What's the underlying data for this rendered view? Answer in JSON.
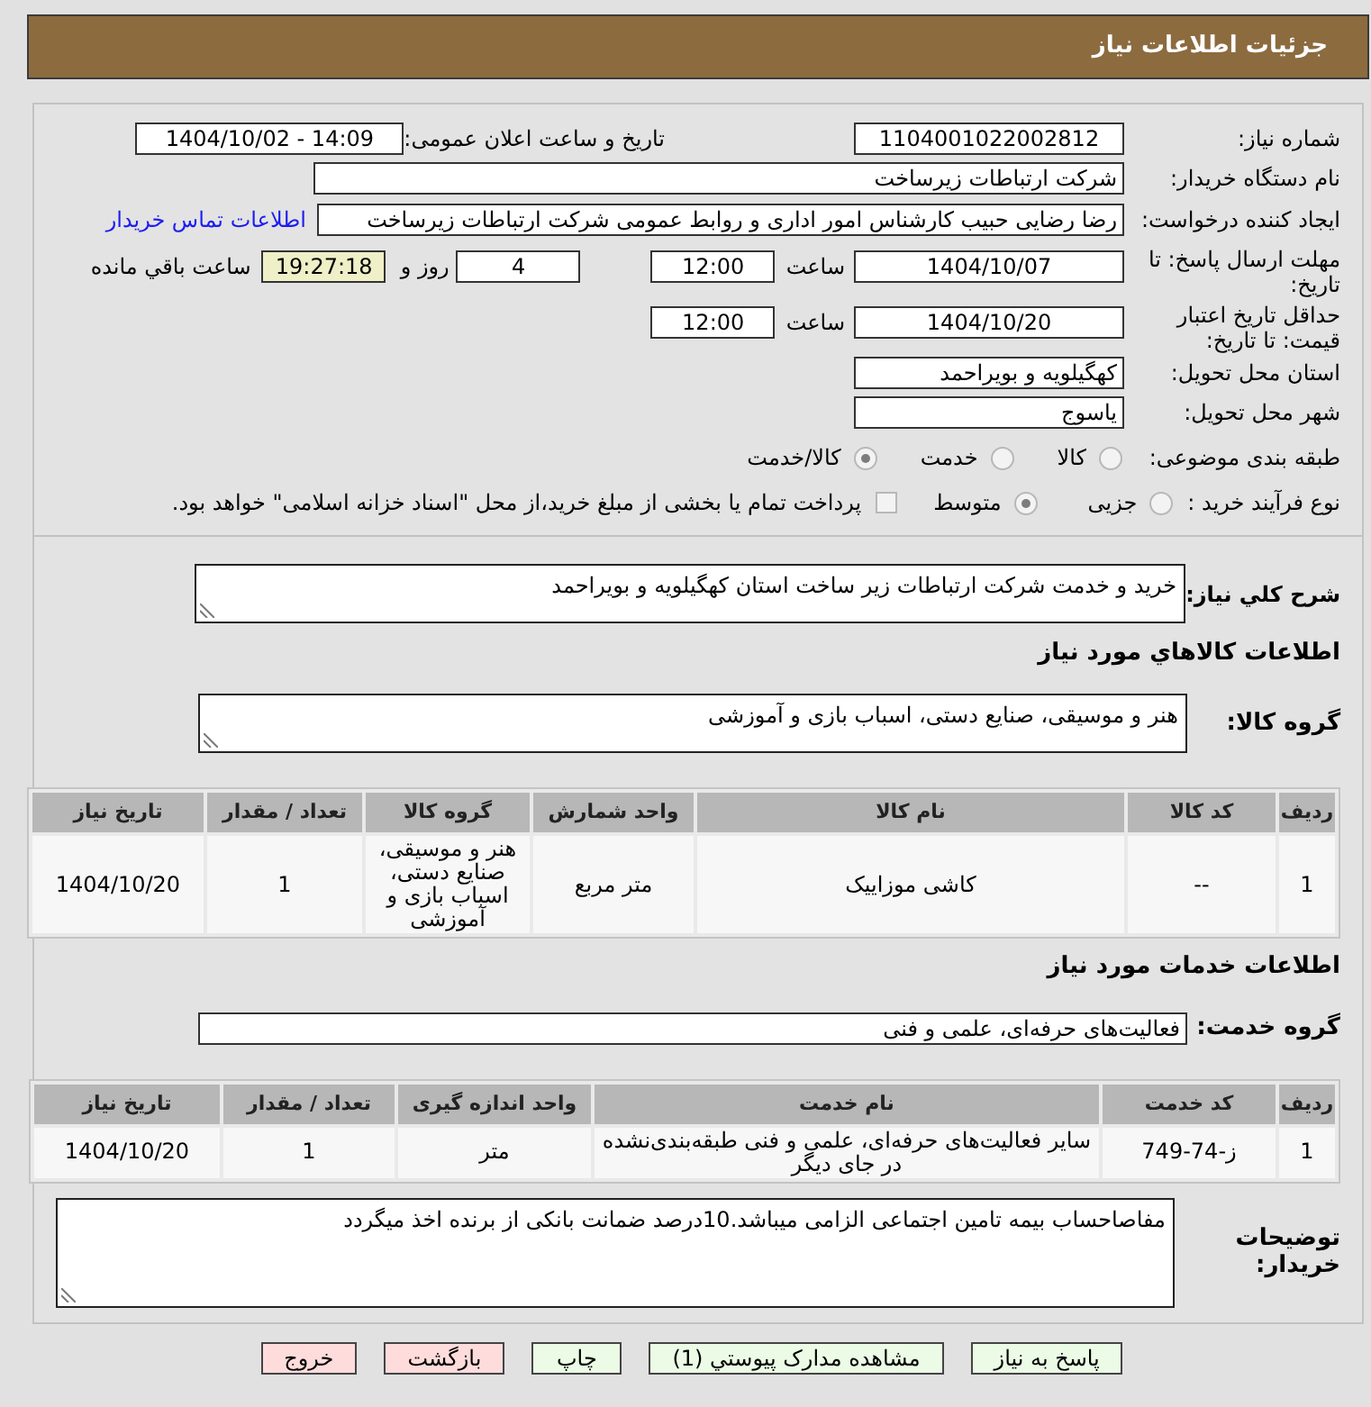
{
  "header": {
    "title": "جزئیات اطلاعات نیاز"
  },
  "details": {
    "need_number": {
      "label": "شماره نیاز:",
      "value": "1104001022002812"
    },
    "announce": {
      "label": "تاریخ و ساعت اعلان عمومی:",
      "value": "1404/10/02 - 14:09"
    },
    "buyer_org": {
      "label": "نام دستگاه خریدار:",
      "value": "شرکت ارتباطات زیرساخت"
    },
    "creator": {
      "label": "ایجاد کننده درخواست:",
      "value": "رضا رضایی حبیب کارشناس امور اداری و روابط عمومی شرکت ارتباطات زیرساخت",
      "contact_link": "اطلاعات تماس خریدار"
    },
    "reply_deadline": {
      "label": "مهلت ارسال پاسخ: تا تاریخ:",
      "date": "1404/10/07",
      "time_label": "ساعت",
      "time": "12:00",
      "days": "4",
      "days_label": "روز و",
      "remaining": "19:27:18",
      "remaining_label": "ساعت باقي مانده"
    },
    "price_validity": {
      "label": "حداقل تاریخ اعتبار قیمت: تا تاریخ:",
      "date": "1404/10/20",
      "time_label": "ساعت",
      "time": "12:00"
    },
    "province": {
      "label": "استان محل تحویل:",
      "value": "کهگیلویه و بویراحمد"
    },
    "city": {
      "label": "شهر محل تحویل:",
      "value": "یاسوج"
    },
    "category": {
      "label": "طبقه بندی موضوعی:",
      "options": [
        {
          "label": "کالا",
          "selected": false
        },
        {
          "label": "خدمت",
          "selected": false
        },
        {
          "label": "کالا/خدمت",
          "selected": true
        }
      ]
    },
    "process": {
      "label": "نوع فرآیند خرید :",
      "options": [
        {
          "label": "جزیی",
          "selected": false
        },
        {
          "label": "متوسط",
          "selected": true
        }
      ],
      "treasury": {
        "label": "پرداخت تمام یا بخشی از مبلغ خرید،از محل \"اسناد خزانه اسلامی\" خواهد بود.",
        "checked": false
      }
    }
  },
  "summary": {
    "label": "شرح کلي نیاز:",
    "value": "خرید و خدمت شرکت ارتباطات زیر ساخت استان کهگیلویه و بویراحمد"
  },
  "goods": {
    "heading": "اطلاعات کالاهاي مورد نیاز",
    "group": {
      "label": "گروه کالا:",
      "value": "هنر و موسیقی، صنایع دستی، اسباب بازی و آموزشی"
    },
    "table": {
      "columns": [
        "ردیف",
        "کد کالا",
        "نام کالا",
        "واحد شمارش",
        "گروه کالا",
        "تعداد / مقدار",
        "تاریخ نیاز"
      ],
      "rows": [
        [
          "1",
          "--",
          "کاشی موزاییک",
          "متر مربع",
          "هنر و موسیقی، صنایع دستی، اسباب بازی و آموزشی",
          "1",
          "1404/10/20"
        ]
      ]
    }
  },
  "services": {
    "heading": "اطلاعات خدمات مورد نیاز",
    "group": {
      "label": "گروه خدمت:",
      "value": "فعالیت‌های حرفه‌ای، علمی و فنی"
    },
    "table": {
      "columns": [
        "ردیف",
        "کد خدمت",
        "نام خدمت",
        "واحد اندازه گیری",
        "تعداد / مقدار",
        "تاریخ نیاز"
      ],
      "rows": [
        [
          "1",
          "ز-74-749",
          "سایر فعالیت‌های حرفه‌ای، علمی و فنی طبقه‌بندی‌نشده در جای دیگر",
          "متر",
          "1",
          "1404/10/20"
        ]
      ]
    }
  },
  "buyer_notes": {
    "label": "توضیحات خریدار:",
    "value": "مفاصاحساب بیمه تامین اجتماعی الزامی میباشد.10درصد ضمانت بانکی  از برنده اخذ میگردد"
  },
  "buttons": [
    {
      "label": "پاسخ به نیاز",
      "color": "#ebfbe5"
    },
    {
      "label": "مشاهده مدارک پیوستي (1)",
      "color": "#ebfbe5"
    },
    {
      "label": "چاپ",
      "color": "#ebfbe5"
    },
    {
      "label": "بازگشت",
      "color": "#ffdcdc"
    },
    {
      "label": "خروج",
      "color": "#ffdcdc"
    }
  ]
}
